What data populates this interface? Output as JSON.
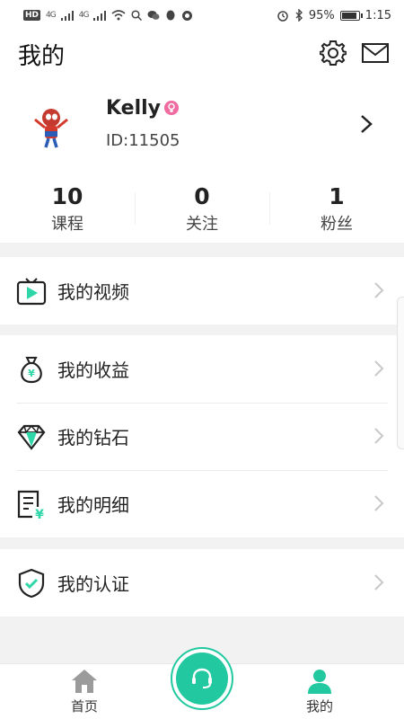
{
  "status_bar": {
    "badge": "HD",
    "network_1": "4G",
    "network_2": "4G",
    "battery_percent": "95%",
    "battery_level": 0.95,
    "time": "1:15"
  },
  "header": {
    "title": "我的"
  },
  "profile": {
    "name": "Kelly",
    "id_text": "ID:11505"
  },
  "stats": [
    {
      "value": "10",
      "label": "课程"
    },
    {
      "value": "0",
      "label": "关注"
    },
    {
      "value": "1",
      "label": "粉丝"
    }
  ],
  "menu": {
    "videos": "我的视频",
    "earnings": "我的收益",
    "diamonds": "我的钻石",
    "details": "我的明细",
    "certification": "我的认证"
  },
  "bottom_nav": {
    "home": "首页",
    "mine": "我的"
  },
  "colors": {
    "accent": "#22c9a0",
    "gender_badge": "#f06ba0"
  }
}
